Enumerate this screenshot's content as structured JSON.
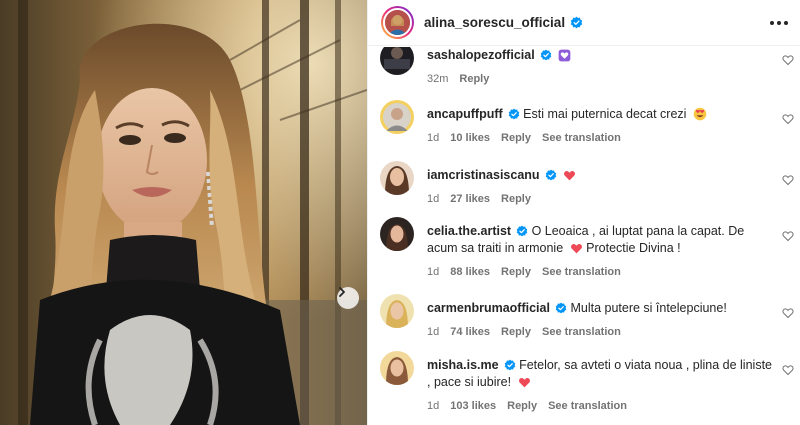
{
  "post": {
    "author": "alina_sorescu_official"
  },
  "comments": [
    {
      "user": "sashalopezofficial",
      "text": "",
      "emoji": "purple-heart-emoji",
      "time": "32m",
      "likes": "",
      "reply": "Reply",
      "translate": ""
    },
    {
      "user": "ancapuffpuff",
      "text": "Esti mai puternica decat crezi",
      "emoji": "heart-eyes-emoji",
      "time": "1d",
      "likes": "10 likes",
      "reply": "Reply",
      "translate": "See translation"
    },
    {
      "user": "iamcristinasiscanu",
      "text": "",
      "emoji": "red-heart-emoji",
      "time": "1d",
      "likes": "27 likes",
      "reply": "Reply",
      "translate": ""
    },
    {
      "user": "celia.the.artist",
      "text": "O Leoaica , ai luptat pana la capat. De acum sa traiti in armonie",
      "text2": "Protectie Divina !",
      "emoji": "red-heart-emoji",
      "time": "1d",
      "likes": "88 likes",
      "reply": "Reply",
      "translate": "See translation"
    },
    {
      "user": "carmenbrumaofficial",
      "text": "Multa putere si întelepciune!",
      "emoji": "",
      "time": "1d",
      "likes": "74 likes",
      "reply": "Reply",
      "translate": "See translation"
    },
    {
      "user": "misha.is.me",
      "text": "Fetelor, sa avteti o viata noua , plina de liniste , pace si iubire!",
      "emoji": "red-heart-emoji",
      "time": "1d",
      "likes": "103 likes",
      "reply": "Reply",
      "translate": "See translation"
    }
  ],
  "colors": {
    "verified": "#0095f6",
    "secondary_text": "#737373",
    "primary_text": "#262626",
    "heart": "#ed4956",
    "purple_heart": "#8e5cd9"
  },
  "icons": {
    "more": "more-options-icon",
    "like": "heart-outline-icon",
    "next": "chevron-right-icon",
    "verified": "verified-badge-icon"
  }
}
